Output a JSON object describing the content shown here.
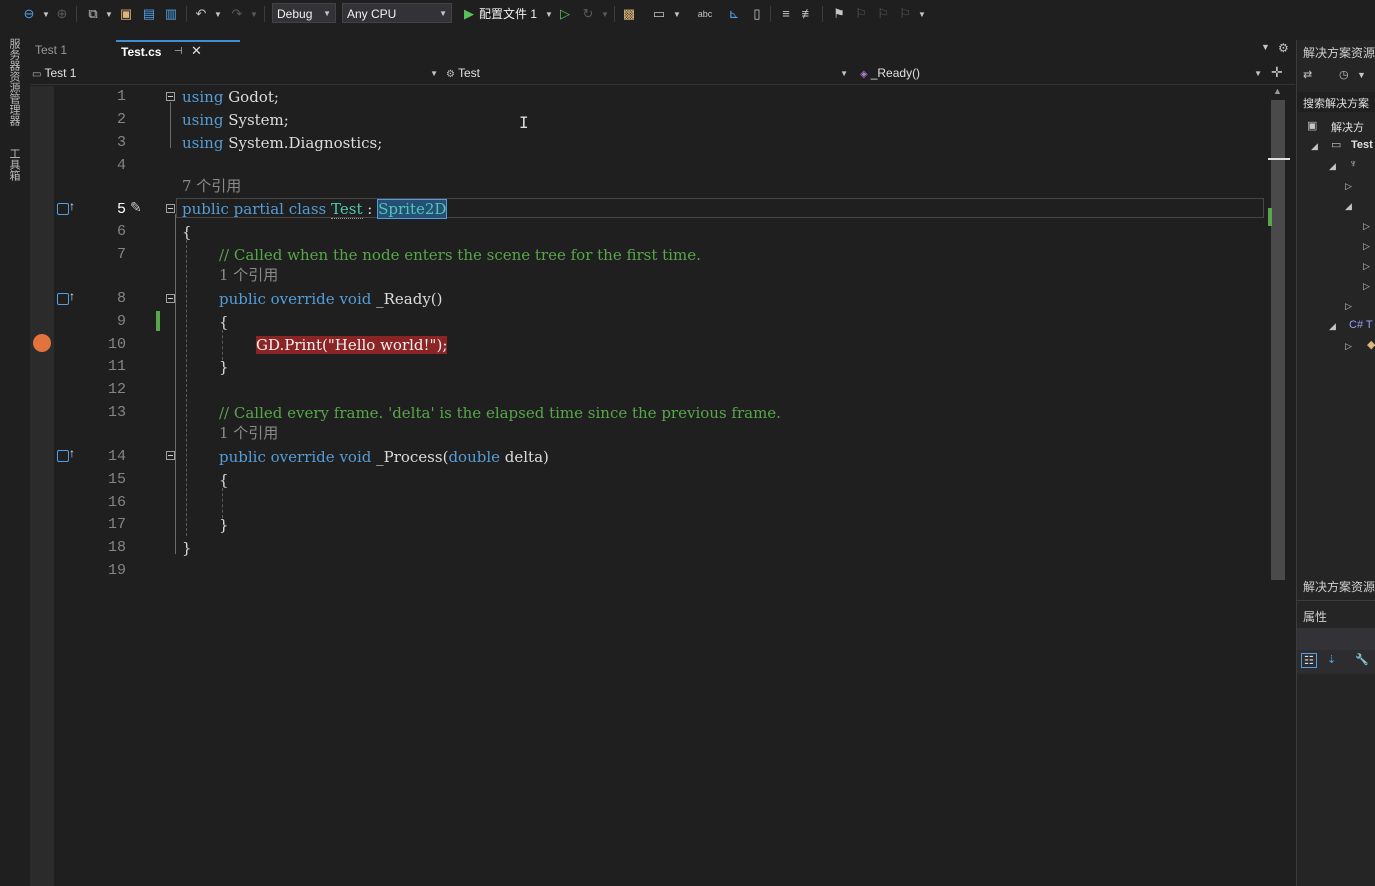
{
  "toolbar": {
    "config": "Debug",
    "platform": "Any CPU",
    "run_label": "配置文件 1"
  },
  "left_strip": {
    "server_explorer": "服务器资源管理器",
    "toolbox": "工具箱"
  },
  "tabs": [
    {
      "label": "Test 1",
      "active": false
    },
    {
      "label": "Test.cs",
      "active": true
    }
  ],
  "navbar": {
    "project": "Test 1",
    "type": "Test",
    "member": "_Ready()"
  },
  "editor": {
    "line_numbers": [
      "1",
      "2",
      "3",
      "4",
      "5",
      "6",
      "7",
      "8",
      "9",
      "10",
      "11",
      "12",
      "13",
      "14",
      "15",
      "16",
      "17",
      "18",
      "19"
    ],
    "current_line": "5",
    "lens_7refs": "7 个引用",
    "lens_1ref_a": "1 个引用",
    "lens_1ref_b": "1 个引用",
    "l1_kw": "using",
    "l1_rest": " Godot;",
    "l2_kw": "using",
    "l2_rest": " System;",
    "l3_kw": "using",
    "l3_rest": " System.Diagnostics;",
    "l5_kw1": "public",
    "l5_kw2": "partial",
    "l5_kw3": "class",
    "l5_name": "Test",
    "l5_colon": " : ",
    "l5_base": "Sprite2D",
    "l6": "{",
    "l7_comment": "// Called when the node enters the scene tree for the first time.",
    "l8_kw1": "public",
    "l8_kw2": "override",
    "l8_kw3": "void",
    "l8_name": " _Ready()",
    "l9": "{",
    "l10": "GD.Print(\"Hello world!\");",
    "l11": "}",
    "l13_comment": "// Called every frame. 'delta' is the elapsed time since the previous frame.",
    "l14_kw1": "public",
    "l14_kw2": "override",
    "l14_kw3": "void",
    "l14_name": " _Process(",
    "l14_type": "double",
    "l14_param": " delta)",
    "l15": "{",
    "l17": "}",
    "l18": "}"
  },
  "right_panel": {
    "solution_explorer_title": "解决方案资源",
    "search_label": "搜索解决方案",
    "solution_node": "解决方",
    "project_node": "Test",
    "csharp_node": "C# T",
    "solution_explorer_tab": "解决方案资源",
    "properties_title": "属性"
  },
  "colors": {
    "background": "#1f1f1f",
    "keyword": "#569cd6",
    "comment": "#57a64a",
    "type": "#4ec9b0",
    "breakpoint": "#e0743c",
    "breakpoint_highlight": "#8b2424"
  }
}
